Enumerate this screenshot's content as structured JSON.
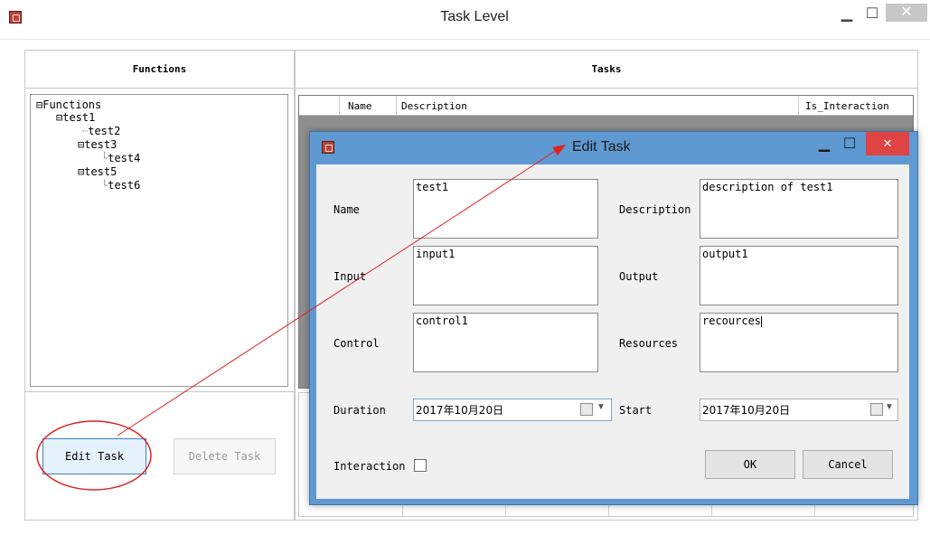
{
  "window": {
    "title": "Task Level"
  },
  "functions_panel": {
    "header": "Functions",
    "tree": [
      {
        "label": "Functions",
        "expander": "⊟"
      },
      {
        "label": "test1",
        "expander": "⊟"
      },
      {
        "label": "test2",
        "expander": ""
      },
      {
        "label": "test3",
        "expander": "⊟"
      },
      {
        "label": "test4",
        "expander": ""
      },
      {
        "label": "test5",
        "expander": "⊟"
      },
      {
        "label": "test6",
        "expander": ""
      }
    ],
    "edit_task_label": "Edit Task",
    "delete_task_label": "Delete Task"
  },
  "tasks_panel": {
    "header": "Tasks",
    "columns": [
      "Name",
      "Description",
      "Is_Interaction"
    ]
  },
  "dialog": {
    "title": "Edit Task",
    "name_label": "Name",
    "name_value": "test1",
    "description_label": "Description",
    "description_value": "description of test1",
    "input_label": "Input",
    "input_value": "input1",
    "output_label": "Output",
    "output_value": "output1",
    "control_label": "Control",
    "control_value": "control1",
    "resources_label": "Resources",
    "resources_value": "recources",
    "duration_label": "Duration",
    "duration_value": "2017年10月20日",
    "start_label": "Start",
    "start_value": "2017年10月20日",
    "interaction_label": "Interaction",
    "interaction_checked": false,
    "ok_label": "OK",
    "cancel_label": "Cancel"
  },
  "colors": {
    "dialog_frame": "#5f99d2",
    "dialog_close": "#e04343",
    "annotation": "#e02020"
  }
}
